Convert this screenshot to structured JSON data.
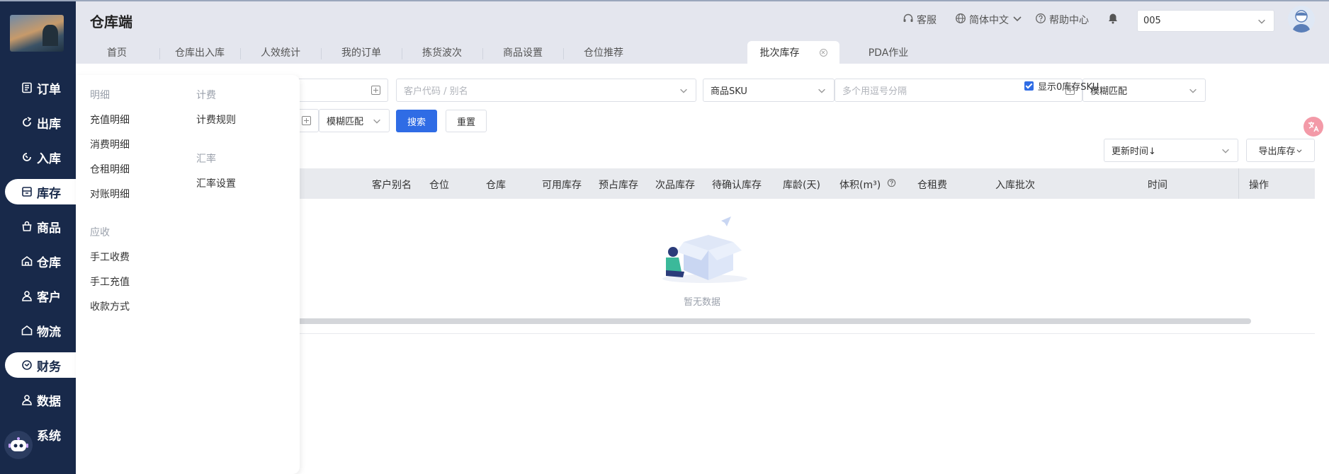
{
  "app": {
    "title": "仓库端"
  },
  "sidebar": {
    "items": [
      {
        "label": "订单",
        "icon": "order-icon"
      },
      {
        "label": "出库",
        "icon": "outbound-icon"
      },
      {
        "label": "入库",
        "icon": "inbound-icon"
      },
      {
        "label": "库存",
        "icon": "inventory-icon",
        "active": true
      },
      {
        "label": "商品",
        "icon": "product-icon"
      },
      {
        "label": "仓库",
        "icon": "warehouse-icon"
      },
      {
        "label": "客户",
        "icon": "customer-icon"
      },
      {
        "label": "物流",
        "icon": "logistics-icon"
      },
      {
        "label": "财务",
        "icon": "finance-icon",
        "active": true
      },
      {
        "label": "数据",
        "icon": "data-icon"
      },
      {
        "label": "系统",
        "icon": "system-icon"
      }
    ]
  },
  "topbar": {
    "service": "客服",
    "language": "简体中文",
    "help": "帮助中心",
    "user_value": "005"
  },
  "tabs": [
    {
      "label": "首页"
    },
    {
      "label": "仓库出入库"
    },
    {
      "label": "人效统计"
    },
    {
      "label": "我的订单"
    },
    {
      "label": "拣货波次"
    },
    {
      "label": "商品设置"
    },
    {
      "label": "仓位推荐"
    },
    {
      "label": "批次库存",
      "active": true
    },
    {
      "label": "PDA作业"
    }
  ],
  "filters": {
    "customer_placeholder": "客户代码 / 别名",
    "sku_select": "商品SKU",
    "multi_placeholder": "多个用逗号分隔",
    "match_select": "模糊匹配",
    "match_select2": "模糊匹配",
    "search_button": "搜索",
    "reset_button": "重置"
  },
  "toolbar": {
    "show_zero_label": "显示0库存SKU",
    "sort_select": "更新时间↓",
    "export_button": "导出库存"
  },
  "table": {
    "headers": [
      "客户别名",
      "仓位",
      "仓库",
      "可用库存",
      "预占库存",
      "次品库存",
      "待确认库存",
      "库龄(天)",
      "体积(m³)",
      "仓租费",
      "入库批次",
      "时间",
      "操作"
    ],
    "empty_text": "暂无数据"
  },
  "finance_menu": {
    "groups": [
      {
        "title": "明细",
        "items": [
          "充值明细",
          "消费明细",
          "仓租明细",
          "对账明细"
        ]
      },
      {
        "title": "计费",
        "items": [
          "计费规则"
        ]
      },
      {
        "title": "汇率",
        "items": [
          "汇率设置"
        ]
      },
      {
        "title": "应收",
        "items": [
          "手工收费",
          "手工充值",
          "收款方式"
        ]
      }
    ]
  },
  "colors": {
    "sidebar_bg": "#18294a",
    "primary": "#2f6ce5",
    "topbar_bg": "#e4e6ee"
  }
}
